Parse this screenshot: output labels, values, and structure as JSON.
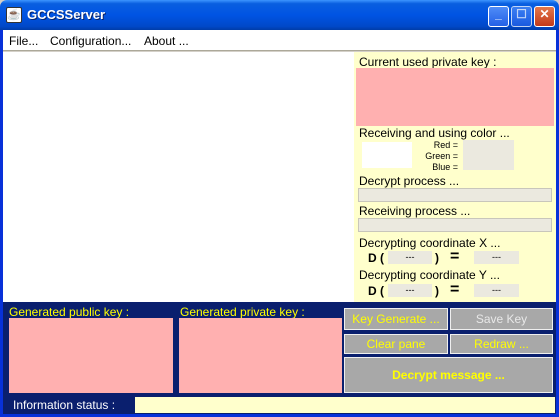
{
  "window": {
    "title": "GCCSServer",
    "icon": "app-icon"
  },
  "menu": {
    "file": "File...",
    "configuration": "Configuration...",
    "about": "About ..."
  },
  "right": {
    "private_key_label": "Current used private key :",
    "color_label": "Receiving and using color ...",
    "red_label": "Red =",
    "green_label": "Green =",
    "blue_label": "Blue =",
    "decrypt_process_label": "Decrypt process ...",
    "receiving_process_label": "Receiving process ...",
    "coord_x_label": "Decrypting coordinate X ...",
    "coord_y_label": "Decrypting coordinate Y ...",
    "d_open": "D (",
    "close_paren": ")",
    "equals": "=",
    "dash": "---"
  },
  "bottom": {
    "public_key_label": "Generated public key :",
    "private_key_label": "Generated private key :",
    "key_generate": "Key Generate ...",
    "save_key": "Save Key",
    "clear_pane": "Clear pane",
    "redraw": "Redraw ...",
    "decrypt_message": "Decrypt message ..."
  },
  "status": {
    "label": "Information status :",
    "value": ""
  },
  "colors": {
    "pink": "#ffb0b0",
    "cream": "#ffffcc",
    "navy": "#0a1f6e",
    "yellow": "#ffff00"
  }
}
